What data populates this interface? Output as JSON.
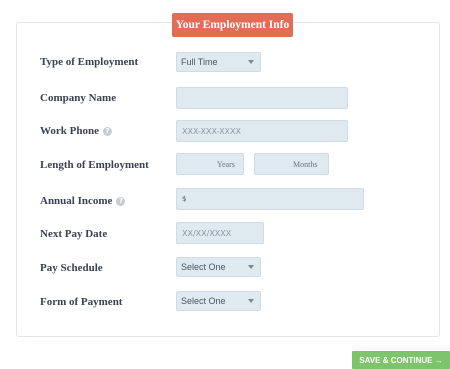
{
  "header": {
    "title": "Your Employment Info"
  },
  "fields": {
    "type_of_employment": {
      "label": "Type of Employment",
      "value": "Full Time"
    },
    "company_name": {
      "label": "Company Name",
      "value": ""
    },
    "work_phone": {
      "label": "Work Phone",
      "placeholder": "XXX-XXX-XXXX"
    },
    "length_of_employment": {
      "label": "Length of Employment",
      "years_unit": "Years",
      "months_unit": "Months"
    },
    "annual_income": {
      "label": "Annual Income",
      "currency_symbol": "$"
    },
    "next_pay_date": {
      "label": "Next Pay Date",
      "placeholder": "XX/XX/XXXX"
    },
    "pay_schedule": {
      "label": "Pay Schedule",
      "value": "Select One"
    },
    "form_of_payment": {
      "label": "Form of Payment",
      "value": "Select One"
    }
  },
  "actions": {
    "save_continue": "SAVE & CONTINUE →"
  },
  "colors": {
    "header_badge": "#e36c57",
    "cta_green": "#7cc56b",
    "field_bg": "#dfe9f0"
  },
  "icons": {
    "help": "help-circle-icon",
    "select_arrow": "chevron-down-icon"
  }
}
